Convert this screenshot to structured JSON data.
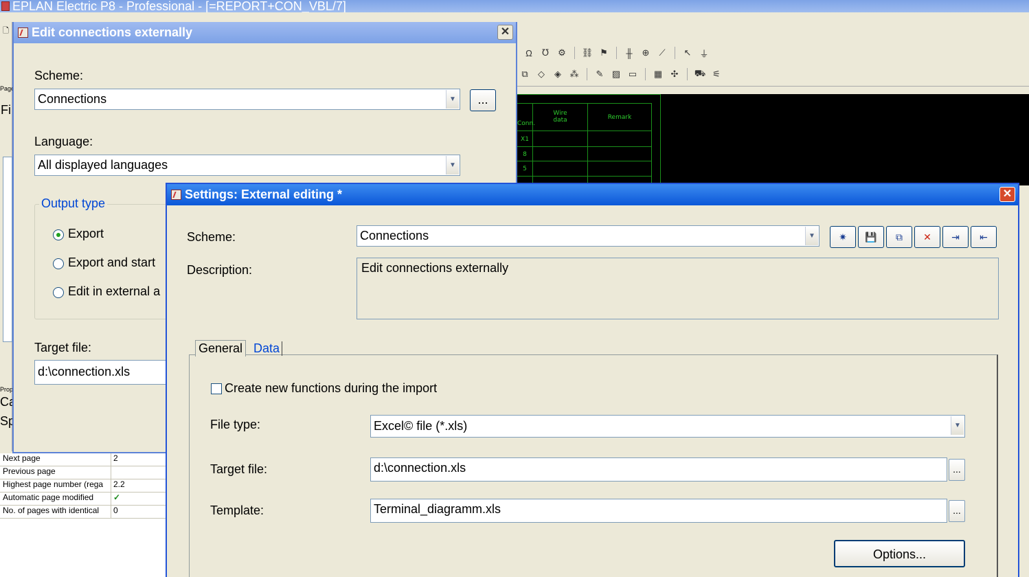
{
  "app": {
    "title": "EPLAN Electric P8 - Professional - [=REPORT+CON_VBL/7]",
    "toolbar1_icons": [
      "omega",
      "ohm",
      "gear",
      "sym",
      "sym",
      "wire",
      "wire",
      "wire",
      "wire",
      "wire"
    ],
    "toolbar2_icons": [
      "grid",
      "shape",
      "shape",
      "shape",
      "edit",
      "hatch",
      "box",
      "table",
      "cross",
      "cart",
      "chart"
    ],
    "left_fragments": [
      "Page",
      "Fi",
      "Prop",
      "Ca",
      "Sp",
      "T"
    ]
  },
  "terminal_table": {
    "headers": [
      "Conn.",
      "Wire\ndata",
      "Remark"
    ],
    "rows": [
      "X1",
      "8",
      "5"
    ]
  },
  "properties": {
    "rows": [
      {
        "key": "Next page",
        "value": "2"
      },
      {
        "key": "Previous page",
        "value": ""
      },
      {
        "key": "Highest page number (rega",
        "value": "2.2"
      },
      {
        "key": "Automatic page modified",
        "value": "✓"
      },
      {
        "key": "No. of pages with identical",
        "value": "0"
      }
    ]
  },
  "dialog1": {
    "title": "Edit connections externally",
    "scheme_label": "Scheme:",
    "scheme_value": "Connections",
    "browse_label": "...",
    "language_label": "Language:",
    "language_value": "All displayed languages",
    "output_type_label": "Output type",
    "options": [
      {
        "label": "Export",
        "selected": true
      },
      {
        "label": "Export and start",
        "selected": false
      },
      {
        "label": "Edit in external a",
        "selected": false
      }
    ],
    "target_label": "Target file:",
    "target_value": "d:\\connection.xls"
  },
  "dialog2": {
    "title": "Settings: External editing *",
    "scheme_label": "Scheme:",
    "scheme_value": "Connections",
    "toolbar_icons": [
      "new-icon",
      "save-icon",
      "copy-icon",
      "delete-icon",
      "import-icon",
      "export-icon"
    ],
    "description_label": "Description:",
    "description_value": "Edit connections externally",
    "tabs": [
      "General",
      "Data"
    ],
    "create_new_label": "Create new functions during the import",
    "file_type_label": "File type:",
    "file_type_value": "Excel© file (*.xls)",
    "target_label": "Target file:",
    "target_value": "d:\\connection.xls",
    "template_label": "Template:",
    "template_value": "Terminal_diagramm.xls",
    "browse_label": "...",
    "options_label": "Options..."
  },
  "colors": {
    "accent": "#2354d8",
    "close_red": "#d64a2b",
    "dialog_bg": "#ece9d8",
    "group_title": "#0046d5",
    "canvas_green": "#2ecc2e"
  }
}
